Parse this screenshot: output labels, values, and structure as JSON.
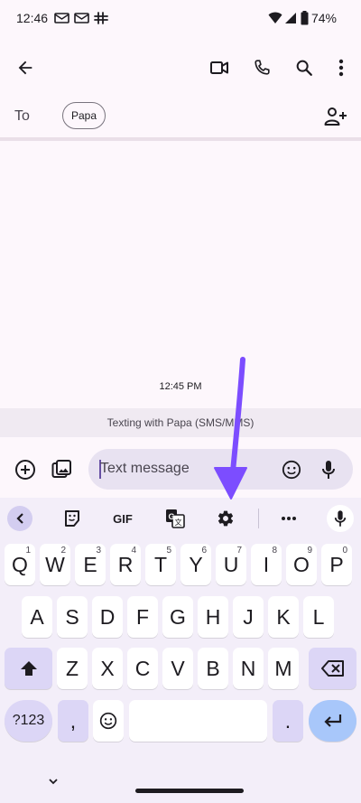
{
  "status": {
    "time": "12:46",
    "battery": "74%"
  },
  "recipient": {
    "to_label": "To",
    "chip": "Papa"
  },
  "thread": {
    "timestamp": "12:45 PM",
    "info": "Texting with Papa (SMS/MMS)"
  },
  "compose": {
    "placeholder": "Text message"
  },
  "keyboard": {
    "gif_label": "GIF",
    "row1": [
      {
        "k": "Q",
        "h": "1"
      },
      {
        "k": "W",
        "h": "2"
      },
      {
        "k": "E",
        "h": "3"
      },
      {
        "k": "R",
        "h": "4"
      },
      {
        "k": "T",
        "h": "5"
      },
      {
        "k": "Y",
        "h": "6"
      },
      {
        "k": "U",
        "h": "7"
      },
      {
        "k": "I",
        "h": "8"
      },
      {
        "k": "O",
        "h": "9"
      },
      {
        "k": "P",
        "h": "0"
      }
    ],
    "row2": [
      "A",
      "S",
      "D",
      "F",
      "G",
      "H",
      "J",
      "K",
      "L"
    ],
    "row3": [
      "Z",
      "X",
      "C",
      "V",
      "B",
      "N",
      "M"
    ],
    "symbols_label": "?123",
    "comma": ",",
    "period": "."
  },
  "colors": {
    "accent": "#7c4dff",
    "key_function": "#dcd6f6"
  }
}
